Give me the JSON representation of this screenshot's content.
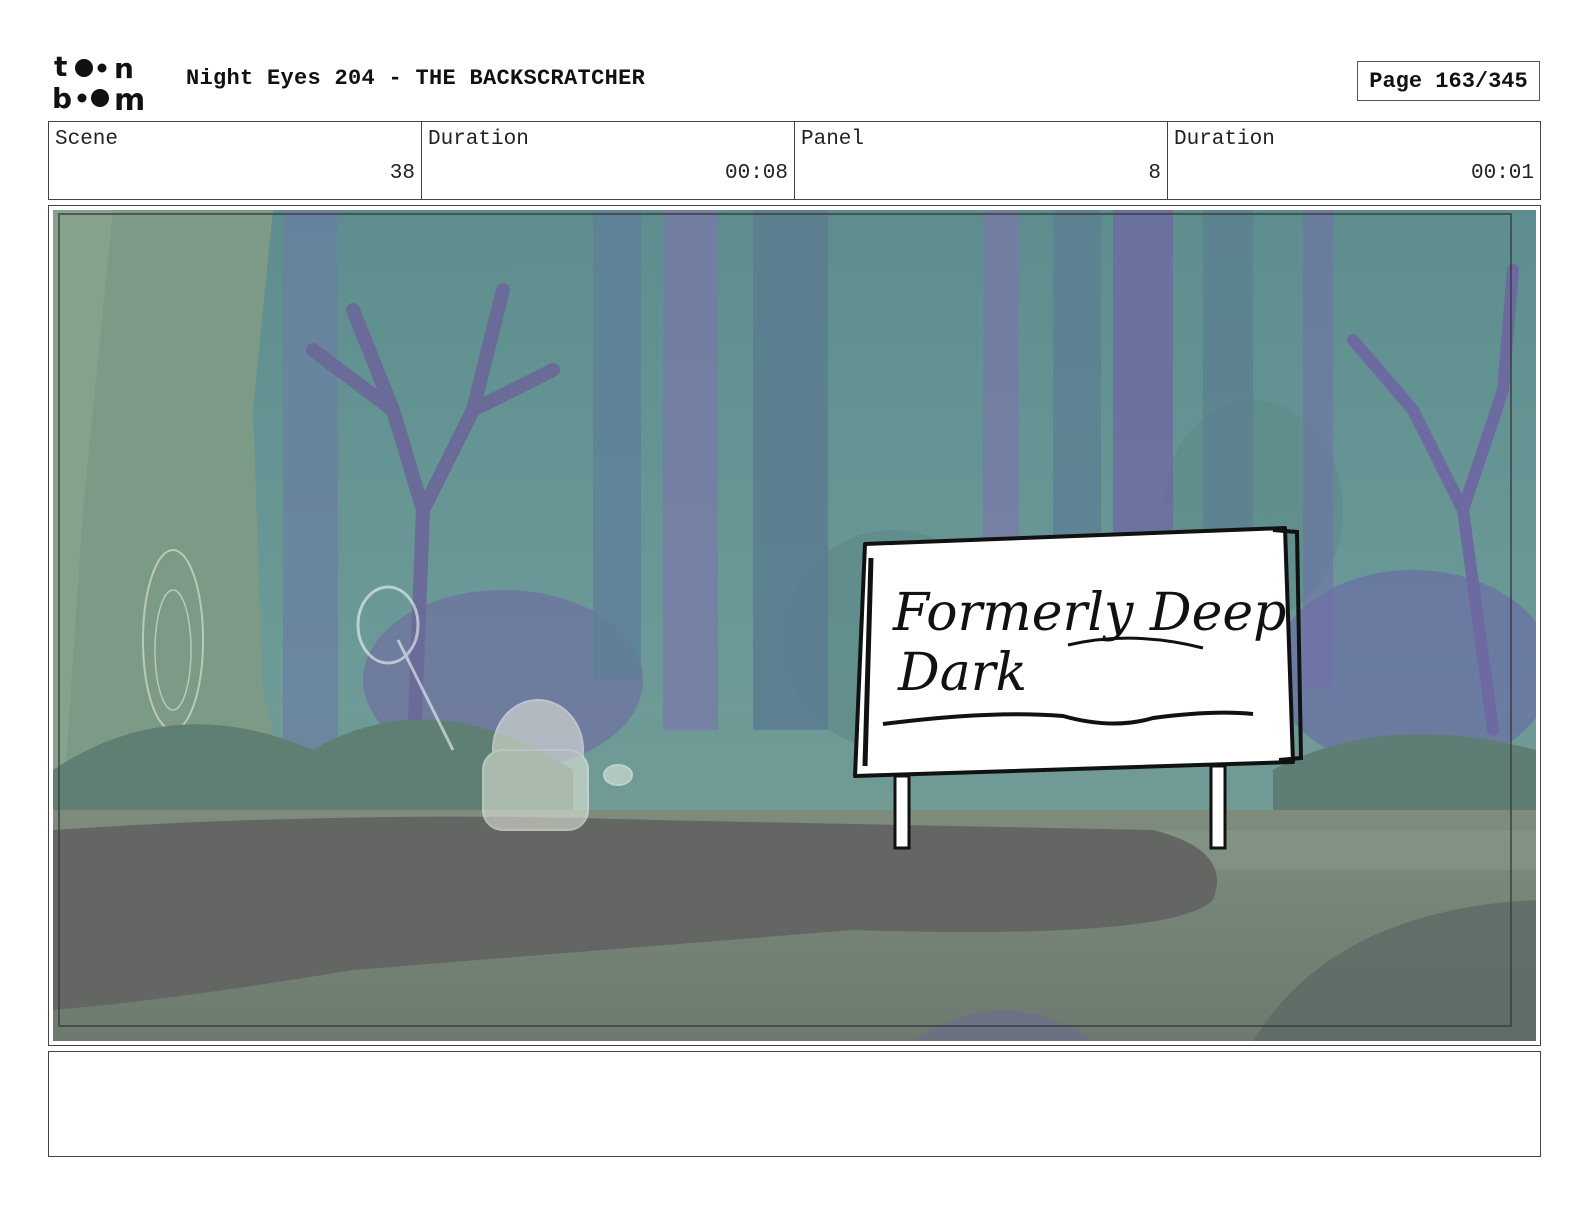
{
  "header": {
    "logo_name": "toonboom-logo",
    "logo_text": "toonboom",
    "title": "Night Eyes 204 - THE BACKSCRATCHER",
    "page_label": "Page 163/345"
  },
  "info": {
    "scene_label": "Scene",
    "scene_value": "38",
    "scene_duration_label": "Duration",
    "scene_duration_value": "00:08",
    "panel_label": "Panel",
    "panel_value": "8",
    "panel_duration_label": "Duration",
    "panel_duration_value": "00:01"
  },
  "panel": {
    "scene_description": "forest-path-storyboard-panel",
    "sign_text": "Formerly Deep Dark"
  },
  "notes": {
    "text": ""
  }
}
